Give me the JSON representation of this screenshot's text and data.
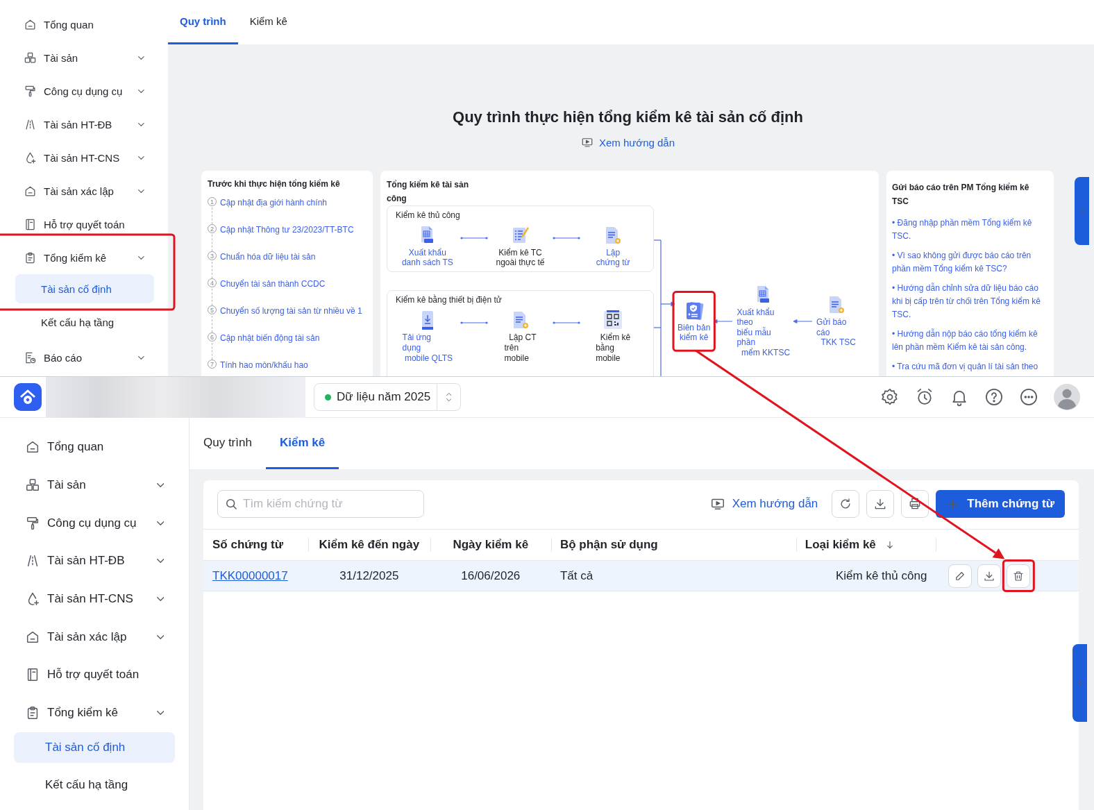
{
  "guide_view": {
    "sidebar": {
      "items": [
        {
          "label": "Tổng quan",
          "has_submenu": false
        },
        {
          "label": "Tài sản",
          "has_submenu": true
        },
        {
          "label": "Công cụ dụng cụ",
          "has_submenu": true
        },
        {
          "label": "Tài sản HT-ĐB",
          "has_submenu": true
        },
        {
          "label": "Tài sản HT-CNS",
          "has_submenu": true
        },
        {
          "label": "Tài sản xác lập",
          "has_submenu": true
        },
        {
          "label": "Hỗ trợ quyết toán",
          "has_submenu": false
        },
        {
          "label": "Tổng kiểm kê",
          "has_submenu": true,
          "highlighted": true,
          "children": [
            {
              "label": "Tài sản cố định",
              "selected": true
            },
            {
              "label": "Kết cấu hạ tầng",
              "selected": false
            }
          ]
        },
        {
          "label": "Báo cáo",
          "has_submenu": true
        }
      ]
    },
    "tabs": [
      {
        "label": "Quy trình",
        "selected": true
      },
      {
        "label": "Kiểm kê",
        "selected": false
      }
    ],
    "title": "Quy trình thực hiện tổng kiểm kê tài sản cố định",
    "guide_link": "Xem hướng dẫn",
    "before": {
      "title": "Trước khi thực hiện tổng kiểm kê",
      "steps": [
        {
          "number": "1",
          "label": "Cập nhật địa giới hành chính"
        },
        {
          "number": "2",
          "label": "Cập nhật Thông tư 23/2023/TT-BTC"
        },
        {
          "number": "3",
          "label": "Chuẩn hóa dữ liệu tài sản"
        },
        {
          "number": "4",
          "label": "Chuyển tài sản thành CCDC"
        },
        {
          "number": "5",
          "label": "Chuyển số lượng tài sản từ nhiều về 1"
        },
        {
          "number": "6",
          "label": "Cập nhật biến động tài sản"
        },
        {
          "number": "7",
          "label": "Tính hao mòn/khấu hao"
        }
      ]
    },
    "inventory": {
      "title": "Tổng kiểm kê tài sản công",
      "groups": [
        {
          "title": "Kiểm kê thủ công",
          "steps": [
            {
              "label": "Xuất khẩu\ndanh sách TS",
              "kind": "link"
            },
            {
              "label": "Kiểm kê TC\nngoài thực tế",
              "kind": "text"
            },
            {
              "label": "Lập\nchứng từ",
              "kind": "link"
            }
          ]
        },
        {
          "title": "Kiểm kê bằng thiết bị điện tử",
          "steps": [
            {
              "label": "Tải ứng\ndụng\n mobile QLTS",
              "kind": "link"
            },
            {
              "label": "  Lập CT\ntrên\nmobile",
              "kind": "text"
            },
            {
              "label": "  Kiểm kê\nbằng\nmobile",
              "kind": "text"
            }
          ]
        }
      ],
      "final_steps": [
        {
          "label": "Biên bản\nkiểm kê",
          "kind": "link",
          "highlighted": true
        },
        {
          "label": "Xuất khẩu\ntheo\nbiểu mẫu\nphần\n  mểm KKTSC",
          "kind": "link",
          "highlighted": false
        },
        {
          "label": "Gửi báo\ncáo\n  TKK TSC",
          "kind": "link",
          "highlighted": false
        }
      ]
    },
    "report": {
      "title": "Gửi báo cáo trên PM Tổng kiểm kê TSC",
      "links": [
        "• Đăng nhập phần mềm Tổng kiểm kê TSC.",
        "• Vì sao không gửi được báo cáo trên phần mềm Tổng kiểm kê TSC?",
        "• Hướng dẫn chỉnh sửa dữ liệu báo cáo khi bị cấp trên từ chối trên Tổng kiểm kê TSC.",
        "• Hướng dẫn nộp báo cáo tổng kiểm kê lên phần mềm Kiểm kê tài sản công.",
        "• Tra cứu mã đơn vị quản lí tài sản theo"
      ]
    }
  },
  "app": {
    "header": {
      "year_label": "Dữ liệu năm 2025"
    },
    "sidebar": {
      "items": [
        {
          "label": "Tổng quan",
          "has_submenu": false
        },
        {
          "label": "Tài sản",
          "has_submenu": true
        },
        {
          "label": "Công cụ dụng cụ",
          "has_submenu": true
        },
        {
          "label": "Tài sản HT-ĐB",
          "has_submenu": true
        },
        {
          "label": "Tài sản HT-CNS",
          "has_submenu": true
        },
        {
          "label": "Tài sản xác lập",
          "has_submenu": true
        },
        {
          "label": "Hỗ trợ quyết toán",
          "has_submenu": false
        },
        {
          "label": "Tổng kiểm kê",
          "has_submenu": true,
          "highlighted": false,
          "children": [
            {
              "label": "Tài sản cố định",
              "selected": true
            },
            {
              "label": "Kết cấu hạ tầng",
              "selected": false
            }
          ]
        }
      ]
    },
    "tabs": [
      {
        "label": "Quy trình",
        "selected": false
      },
      {
        "label": "Kiểm kê",
        "selected": true
      }
    ],
    "search": {
      "placeholder": "Tìm kiếm chứng từ"
    },
    "guide_link": "Xem hướng dẫn",
    "add_button": "Thêm chứng từ",
    "table": {
      "columns": [
        {
          "label": "Số chứng từ",
          "sorted": false
        },
        {
          "label": "Kiểm kê đến ngày",
          "sorted": false
        },
        {
          "label": "Ngày kiểm kê",
          "sorted": false
        },
        {
          "label": "Bộ phận sử dụng",
          "sorted": false
        },
        {
          "label": "Loại kiểm kê",
          "sorted": true
        }
      ],
      "rows": [
        {
          "selected": true,
          "cells": [
            "TKK00000017",
            "31/12/2025",
            "16/06/2026",
            "Tất cả",
            "Kiểm kê thủ công"
          ],
          "actions": [
            {
              "kind": "edit",
              "highlighted": false
            },
            {
              "kind": "download",
              "highlighted": false
            },
            {
              "kind": "delete",
              "highlighted": true
            }
          ]
        }
      ]
    }
  }
}
